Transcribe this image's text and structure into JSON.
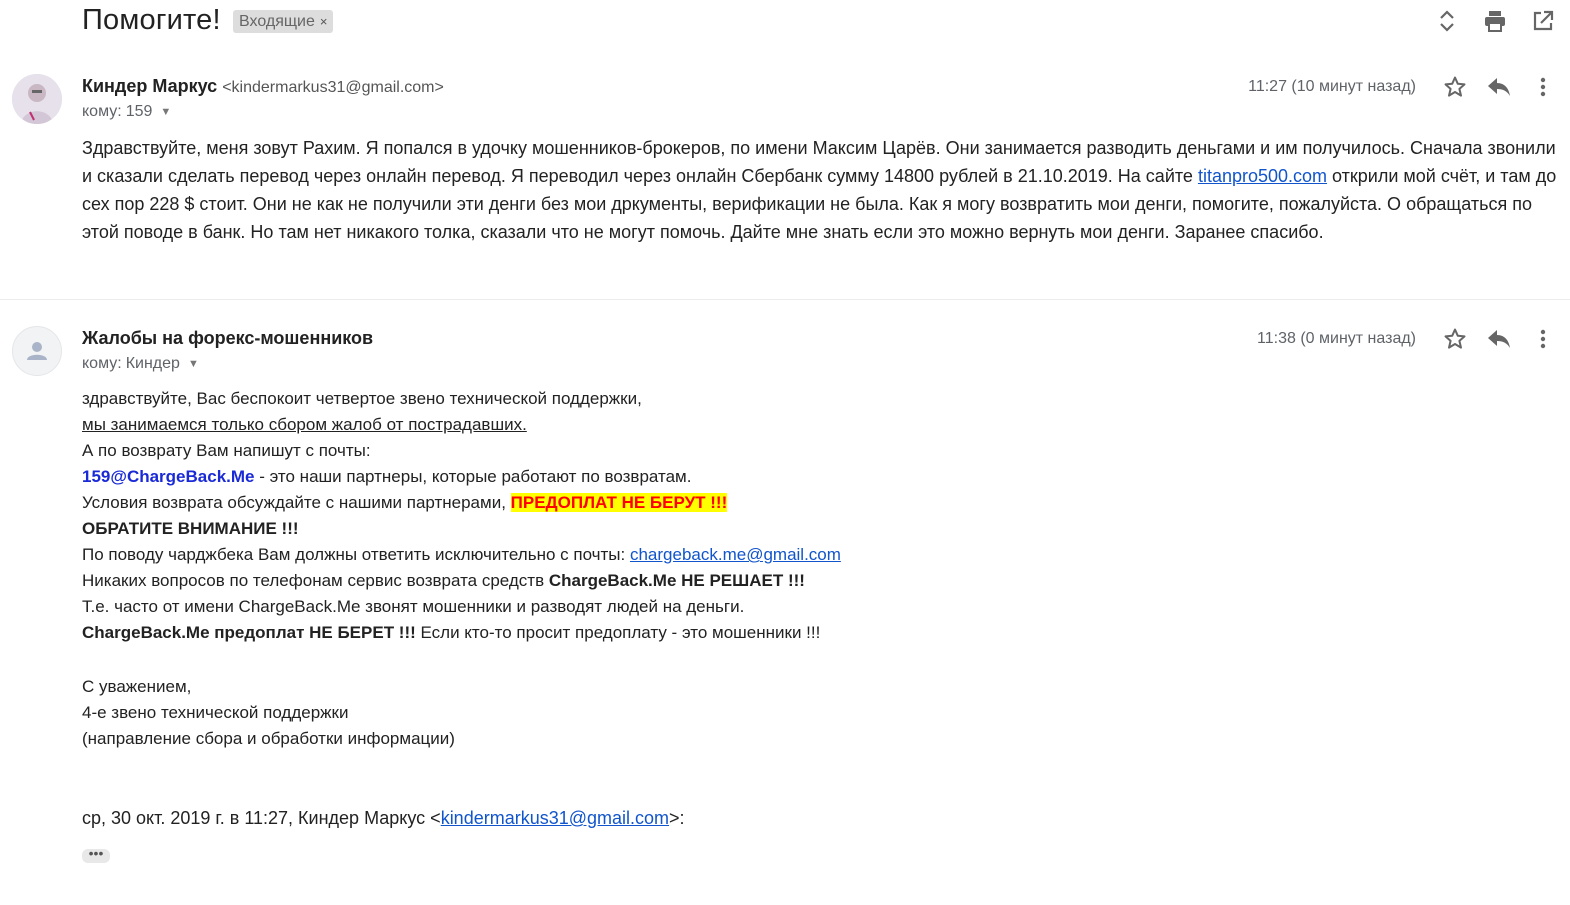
{
  "thread": {
    "subject": "Помогите!",
    "label": "Входящие",
    "label_remove": "×",
    "icons": [
      "expand-collapse-icon",
      "print-icon",
      "open-in-new-window-icon"
    ]
  },
  "message1": {
    "sender_name": "Киндер Маркус",
    "sender_email": "<kindermarkus31@gmail.com>",
    "to_label": "кому:",
    "to_value": "159",
    "timestamp": "11:27 (10 минут назад)",
    "body_part1": "Здравствуйте, меня зовут Рахим. Я попался в удочку мошенников-брокеров, по имени Максим Царёв. Они занимается разводить деньгами и им получилось. Сначала звонили и сказали сделать перевод через онлайн перевод. Я переводил через онлайн Сбербанк сумму 14800 рублей в 21.10.2019. На сайте ",
    "body_link": "titanpro500.com",
    "body_part2": " открили мой счёт, и там до сех пор 228 $ стоит. Они не как не получили эти денги без мои дркументы, верификации не была. Как я могу возвратить мои денги, помогите, пожалуйста. О обращаться по этой поводе в банк. Но там нет никакого толка, сказали что не могут помочь. Дайте мне знать если это можно вернуть мои денги. Заранее спасибо."
  },
  "message2": {
    "sender_name": "Жалобы на форекс-мошенников",
    "to_label": "кому:",
    "to_value": "Киндер",
    "timestamp": "11:38 (0 минут назад)",
    "l1": "здравствуйте, Вас беспокоит четвертое звено технической поддержки,",
    "l2": "мы занимаемся только сбором жалоб от пострадавших.",
    "l3": "А по возврату Вам напишут с почты:",
    "l4_email": "159@ChargeBack.Me",
    "l4_rest": " - это наши партнеры, которые работают по возвратам.",
    "l5_text": "Условия возврата обсуждайте с нашими партнерами, ",
    "l5_highlight": "ПРЕДОПЛАТ НЕ БЕРУТ !!!",
    "l6": "ОБРАТИТЕ ВНИМАНИЕ !!!",
    "l7_text": "По поводу чарджбека Вам должны ответить исключительно с почты: ",
    "l7_link": "chargeback.me@gmail.com",
    "l8_text": "Никаких вопросов по телефонам сервис возврата средств ",
    "l8_bold": "ChargeBack.Me НЕ РЕШАЕТ !!!",
    "l9": "Т.е. часто от имени ChargeBack.Me звонят мошенники и разводят людей на деньги.",
    "l10_bold": "ChargeBack.Me предоплат НЕ БЕРЕТ !!!",
    "l10_rest": " Если кто-то просит предоплату - это мошенники !!!",
    "sig1": "С уважением,",
    "sig2": "4-е звено технической поддержки",
    "sig3": "(направление сбора и обработки информации)",
    "quote_prefix": "ср, 30 окт. 2019 г. в 11:27, Киндер Маркус <",
    "quote_link": "kindermarkus31@gmail.com",
    "quote_suffix": ">:",
    "show_trimmed": "•••"
  },
  "colors": {
    "link": "#1155cc",
    "highlight_bg": "#ffff00",
    "highlight_text": "#ff0000",
    "email_blue": "#1a2ad6"
  }
}
